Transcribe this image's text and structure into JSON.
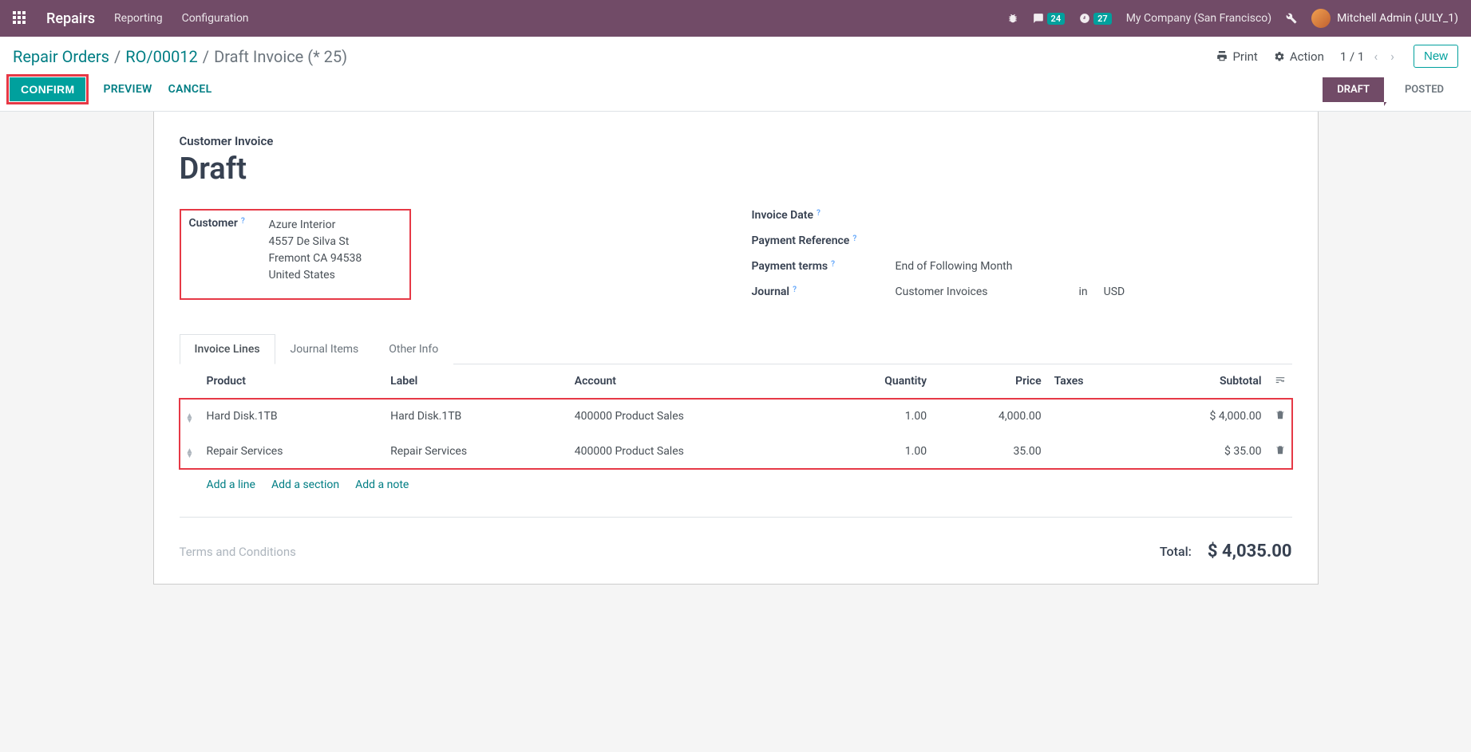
{
  "navbar": {
    "brand": "Repairs",
    "menus": [
      "Reporting",
      "Configuration"
    ],
    "messages_badge": "24",
    "activities_badge": "27",
    "company": "My Company (San Francisco)",
    "user": "Mitchell Admin (JULY_1)"
  },
  "control_panel": {
    "breadcrumb": {
      "root": "Repair Orders",
      "parent": "RO/00012",
      "current": "Draft Invoice (* 25)"
    },
    "print": "Print",
    "action": "Action",
    "pager": "1 / 1",
    "new_btn": "New",
    "buttons": {
      "confirm": "CONFIRM",
      "preview": "PREVIEW",
      "cancel": "CANCEL"
    },
    "status": {
      "draft": "DRAFT",
      "posted": "POSTED"
    }
  },
  "form": {
    "doc_type": "Customer Invoice",
    "title": "Draft",
    "customer_label": "Customer",
    "customer": {
      "name": "Azure Interior",
      "street": "4557 De Silva St",
      "city_line": "Fremont CA 94538",
      "country": "United States"
    },
    "right_labels": {
      "invoice_date": "Invoice Date",
      "payment_reference": "Payment Reference",
      "payment_terms": "Payment terms",
      "journal": "Journal"
    },
    "right_values": {
      "payment_terms": "End of Following Month",
      "journal": "Customer Invoices",
      "journal_sep": "in",
      "currency": "USD"
    },
    "tabs": {
      "invoice_lines": "Invoice Lines",
      "journal_items": "Journal Items",
      "other_info": "Other Info"
    },
    "headers": {
      "product": "Product",
      "label": "Label",
      "account": "Account",
      "quantity": "Quantity",
      "price": "Price",
      "taxes": "Taxes",
      "subtotal": "Subtotal"
    },
    "lines": [
      {
        "product": "Hard Disk.1TB",
        "label": "Hard Disk.1TB",
        "account": "400000 Product Sales",
        "quantity": "1.00",
        "price": "4,000.00",
        "taxes": "",
        "subtotal": "$ 4,000.00"
      },
      {
        "product": "Repair Services",
        "label": "Repair Services",
        "account": "400000 Product Sales",
        "quantity": "1.00",
        "price": "35.00",
        "taxes": "",
        "subtotal": "$ 35.00"
      }
    ],
    "line_actions": {
      "add_line": "Add a line",
      "add_section": "Add a section",
      "add_note": "Add a note"
    },
    "terms_placeholder": "Terms and Conditions",
    "total_label": "Total:",
    "total_value": "$ 4,035.00"
  }
}
